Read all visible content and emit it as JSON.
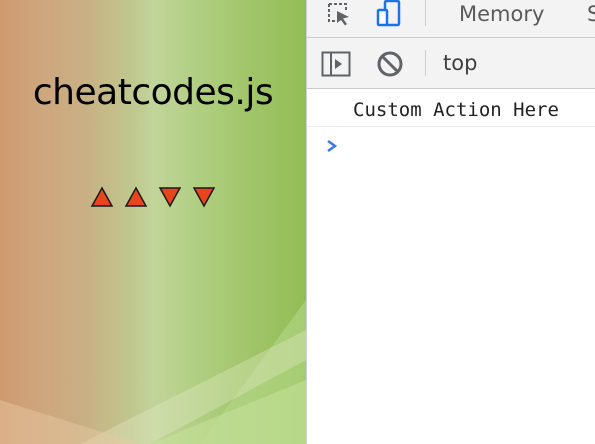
{
  "page": {
    "title": "cheatcodes.js",
    "arrows": [
      "up",
      "up",
      "down",
      "down"
    ],
    "arrow_color": "#e8451f"
  },
  "devtools": {
    "tabs": {
      "memory": "Memory",
      "next_partial": "S"
    },
    "toolbar_icons": [
      "inspect-element-icon",
      "device-toolbar-icon"
    ],
    "console_toolbar": {
      "icons": [
        "sidebar-toggle-icon",
        "clear-console-icon"
      ],
      "context": "top"
    },
    "console": {
      "messages": [
        "Custom Action Here"
      ],
      "prompt_color": "#3b78e7"
    }
  }
}
